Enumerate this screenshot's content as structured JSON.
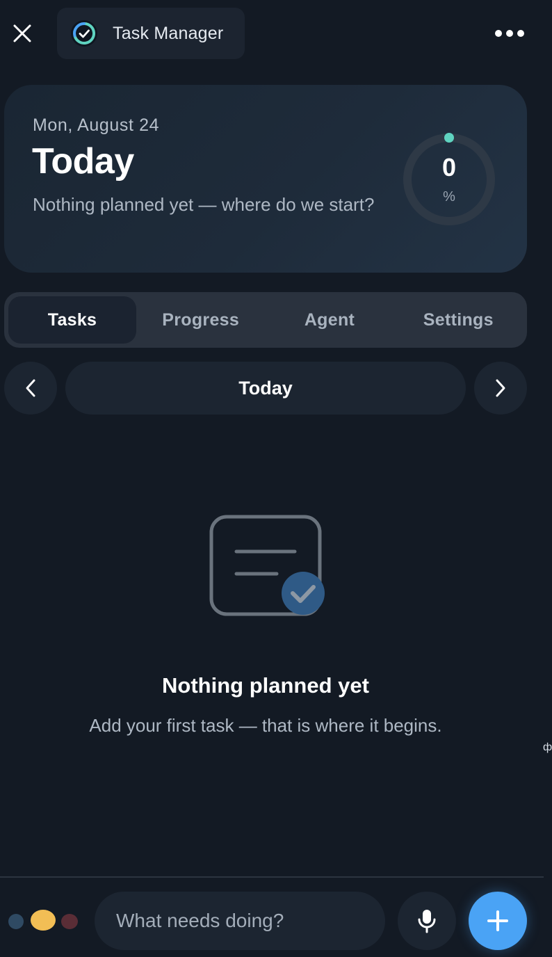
{
  "header": {
    "app_title": "Task Manager",
    "close_icon": "close-icon",
    "more_icon": "more-horizontal-icon"
  },
  "hero": {
    "date": "Mon, August 24",
    "title": "Today",
    "subtitle": "Nothing planned yet — where do we start?",
    "progress_value": "0",
    "progress_unit": "%",
    "progress_fraction": 0
  },
  "tabs": [
    {
      "label": "Tasks",
      "active": true
    },
    {
      "label": "Progress",
      "active": false
    },
    {
      "label": "Agent",
      "active": false
    },
    {
      "label": "Settings",
      "active": false
    }
  ],
  "date_nav": {
    "label": "Today",
    "prev_icon": "chevron-left-icon",
    "next_icon": "chevron-right-icon"
  },
  "empty_state": {
    "icon": "note-check-icon",
    "title": "Nothing planned yet",
    "subtitle": "Add your first task — that is where it begins."
  },
  "edge_glyph": "ф",
  "composer": {
    "placeholder": "What needs doing?",
    "mic_icon": "microphone-icon",
    "add_icon": "plus-icon",
    "status_dots": [
      "#2f4a63",
      "#f2be55",
      "#5a2d36"
    ]
  },
  "colors": {
    "background": "#131a24",
    "accent": "#4aa3f5",
    "ring_indicator": "#5fd3c0"
  }
}
